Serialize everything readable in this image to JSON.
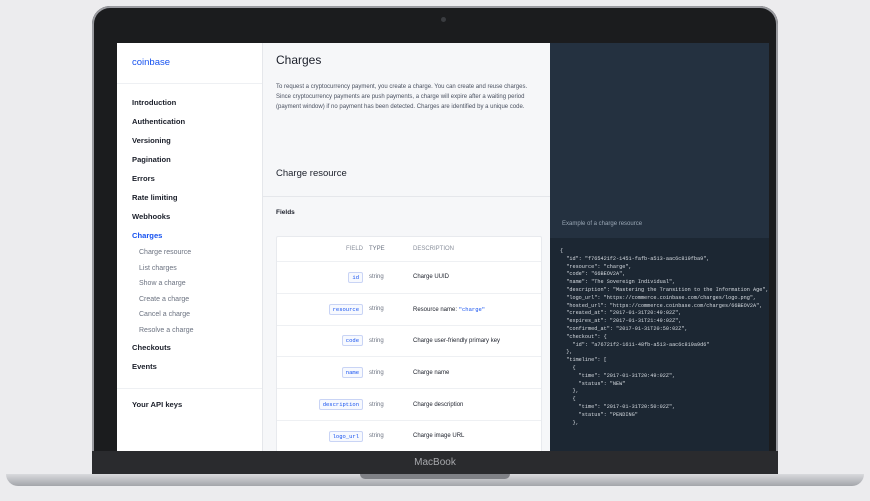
{
  "device": {
    "label": "MacBook"
  },
  "sidebar": {
    "logo": "coinbase",
    "items": [
      {
        "label": "Introduction"
      },
      {
        "label": "Authentication"
      },
      {
        "label": "Versioning"
      },
      {
        "label": "Pagination"
      },
      {
        "label": "Errors"
      },
      {
        "label": "Rate limiting"
      },
      {
        "label": "Webhooks"
      },
      {
        "label": "Charges"
      }
    ],
    "sub_items": [
      {
        "label": "Charge resource"
      },
      {
        "label": "List charges"
      },
      {
        "label": "Show a charge"
      },
      {
        "label": "Create a charge"
      },
      {
        "label": "Cancel a charge"
      },
      {
        "label": "Resolve a charge"
      }
    ],
    "after_items": [
      {
        "label": "Checkouts"
      },
      {
        "label": "Events"
      }
    ],
    "api_keys": "Your API keys"
  },
  "main": {
    "title": "Charges",
    "intro": "To request a cryptocurrency payment, you create a charge. You can create and reuse charges. Since cryptocurrency payments are push payments, a charge will expire after a waiting period (payment window) if no payment has been detected. Charges are identified by a unique code.",
    "section_title": "Charge resource",
    "fields_label": "Fields",
    "columns": {
      "field": "FIELD",
      "type": "TYPE",
      "description": "DESCRIPTION"
    },
    "rows": [
      {
        "field": "id",
        "type": "string",
        "description": "Charge UUID",
        "code": ""
      },
      {
        "field": "resource",
        "type": "string",
        "description": "Resource name: ",
        "code": "\"charge\""
      },
      {
        "field": "code",
        "type": "string",
        "description": "Charge user-friendly primary key",
        "code": ""
      },
      {
        "field": "name",
        "type": "string",
        "description": "Charge name",
        "code": ""
      },
      {
        "field": "description",
        "type": "string",
        "description": "Charge description",
        "code": ""
      },
      {
        "field": "logo_url",
        "type": "string",
        "description": "Charge image URL",
        "code": ""
      }
    ]
  },
  "code_panel": {
    "caption": "Example of a charge resource",
    "code": "{\n  \"id\": \"f765421f2-1451-fafb-a513-aac6c819fba9\",\n  \"resource\": \"charge\",\n  \"code\": \"66BEOV2A\",\n  \"name\": \"The Sovereign Individual\",\n  \"description\": \"Mastering the Transition to the Information Age\",\n  \"logo_url\": \"https://commerce.coinbase.com/charges/logo.png\",\n  \"hosted_url\": \"https://commerce.coinbase.com/charges/66BEOV2A\",\n  \"created_at\": \"2017-01-31T20:49:02Z\",\n  \"expires_at\": \"2017-01-31T21:49:02Z\",\n  \"confirmed_at\": \"2017-01-31T20:50:02Z\",\n  \"checkout\": {\n    \"id\": \"a76721f2-1611-48fb-a513-aac6c819a9d6\"\n  },\n  \"timeline\": [\n    {\n      \"time\": \"2017-01-31T20:49:02Z\",\n      \"status\": \"NEW\"\n    },\n    {\n      \"time\": \"2017-01-31T20:50:02Z\",\n      \"status\": \"PENDING\"\n    },"
  }
}
